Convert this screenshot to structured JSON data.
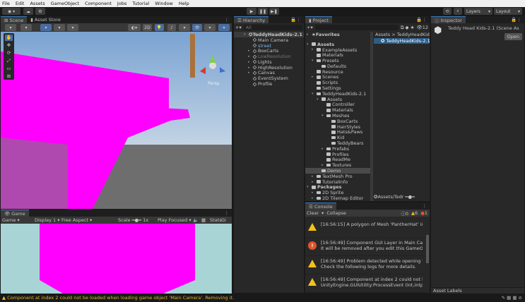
{
  "menu": [
    "File",
    "Edit",
    "Assets",
    "GameObject",
    "Component",
    "Jobs",
    "Tutorial",
    "Window",
    "Help"
  ],
  "toolbar": {
    "layers": "Layers",
    "layout": "Layout"
  },
  "scene": {
    "tabs": [
      "Scene",
      "Asset Store"
    ],
    "mode_2d": "2D",
    "persp": "Persp"
  },
  "game": {
    "tab": "Game",
    "view": "Game",
    "display": "Display 1",
    "aspect": "Free Aspect",
    "scale_label": "Scale",
    "scale_value": "1x",
    "play_mode": "Play Focused",
    "stats": "Stats",
    "gizmos": "Gi"
  },
  "hierarchy": {
    "title": "Hierarchy",
    "search_placeholder": "All",
    "root": "TeddyHeadKids-2.1",
    "items": [
      {
        "label": "Main Camera",
        "fold": false,
        "dim": false,
        "sel": false
      },
      {
        "label": "street",
        "fold": false,
        "dim": false,
        "sel": true
      },
      {
        "label": "BoxCarts",
        "fold": true,
        "dim": false,
        "sel": false
      },
      {
        "label": "LowResolution",
        "fold": true,
        "dim": true,
        "sel": false
      },
      {
        "label": "Lights",
        "fold": true,
        "dim": false,
        "sel": false
      },
      {
        "label": "HighResolution",
        "fold": true,
        "dim": false,
        "sel": false
      },
      {
        "label": "Canvas",
        "fold": true,
        "dim": false,
        "sel": false
      },
      {
        "label": "EventSystem",
        "fold": false,
        "dim": false,
        "sel": false
      },
      {
        "label": "Profile",
        "fold": false,
        "dim": false,
        "sel": false
      }
    ]
  },
  "project": {
    "title": "Project",
    "hidden_count": "12",
    "breadcrumb": "Assets > TeddyHeadKids-",
    "asset_selected": "TeddyHeadKids-2.1",
    "footer_path": "Assets/Tedr",
    "tree": [
      {
        "label": "Favorites",
        "d": 0,
        "a": "▸",
        "bold": true
      },
      {
        "label": "Assets",
        "d": 0,
        "a": "▾",
        "bold": true
      },
      {
        "label": "ExampleAssets",
        "d": 1,
        "a": "▸"
      },
      {
        "label": "Materials",
        "d": 1,
        "a": ""
      },
      {
        "label": "Presets",
        "d": 1,
        "a": "▾"
      },
      {
        "label": "Defaults",
        "d": 2,
        "a": ""
      },
      {
        "label": "Resource",
        "d": 1,
        "a": ""
      },
      {
        "label": "Scenes",
        "d": 1,
        "a": "▸"
      },
      {
        "label": "Scripts",
        "d": 1,
        "a": ""
      },
      {
        "label": "Settings",
        "d": 1,
        "a": ""
      },
      {
        "label": "TeddyHeadKids-2.1",
        "d": 1,
        "a": "▾"
      },
      {
        "label": "Assets",
        "d": 2,
        "a": "▾"
      },
      {
        "label": "Controller",
        "d": 3,
        "a": ""
      },
      {
        "label": "Materials",
        "d": 3,
        "a": ""
      },
      {
        "label": "Meshes",
        "d": 3,
        "a": "▾"
      },
      {
        "label": "BoxCarts",
        "d": 4,
        "a": ""
      },
      {
        "label": "HairStyles",
        "d": 4,
        "a": ""
      },
      {
        "label": "Hats&Paws",
        "d": 4,
        "a": ""
      },
      {
        "label": "Kid",
        "d": 4,
        "a": ""
      },
      {
        "label": "TeddyBears",
        "d": 4,
        "a": ""
      },
      {
        "label": "Prefabs",
        "d": 3,
        "a": "▸"
      },
      {
        "label": "Profiles",
        "d": 3,
        "a": ""
      },
      {
        "label": "ReadMe",
        "d": 3,
        "a": ""
      },
      {
        "label": "Textures",
        "d": 3,
        "a": "▸"
      },
      {
        "label": "Demo",
        "d": 2,
        "a": "",
        "sel": true
      },
      {
        "label": "TextMesh Pro",
        "d": 1,
        "a": "▸"
      },
      {
        "label": "TutorialInfo",
        "d": 1,
        "a": "▸"
      },
      {
        "label": "Packages",
        "d": 0,
        "a": "▾",
        "bold": true
      },
      {
        "label": "2D Sprite",
        "d": 1,
        "a": "▸"
      },
      {
        "label": "2D Tilemap Editor",
        "d": 1,
        "a": "▸"
      },
      {
        "label": "Burst",
        "d": 1,
        "a": "▸"
      }
    ]
  },
  "console": {
    "title": "Console",
    "clear": "Clear",
    "collapse": "Collapse",
    "info_count": "0",
    "warn_count": "6",
    "error_count": "1",
    "logs": [
      {
        "type": "warning",
        "line1": "[16:56:15] A polygon of Mesh 'PantherHat' in Assets/T",
        "line2": ""
      },
      {
        "type": "error",
        "line1": "[16:56:49] Component GUI Layer in Main Camera for S",
        "line2": "It will be removed after you edit this GameObject and :"
      },
      {
        "type": "warning",
        "line1": "[16:56:49] Problem detected while opening the Scene",
        "line2": "Check the following logs for more details."
      },
      {
        "type": "warning",
        "line1": "[16:56:49] Component at index 2 could not be loaded",
        "line2": "UnityEngine.GUIUtility:ProcessEvent (int,intptr,bool&)"
      }
    ]
  },
  "inspector": {
    "title": "Inspector",
    "object": "Teddy Head Kids-2.1 (Scene As",
    "open": "Open",
    "asset_labels": "Asset Labels"
  },
  "status": {
    "message": "Component at index 2 could not be loaded when loading game object 'Main Camera'. Removing it."
  },
  "colors": {
    "magenta": "#ff00ff",
    "selection": "#2c5d87",
    "warning": "#f2c21b",
    "error": "#e0552c"
  }
}
